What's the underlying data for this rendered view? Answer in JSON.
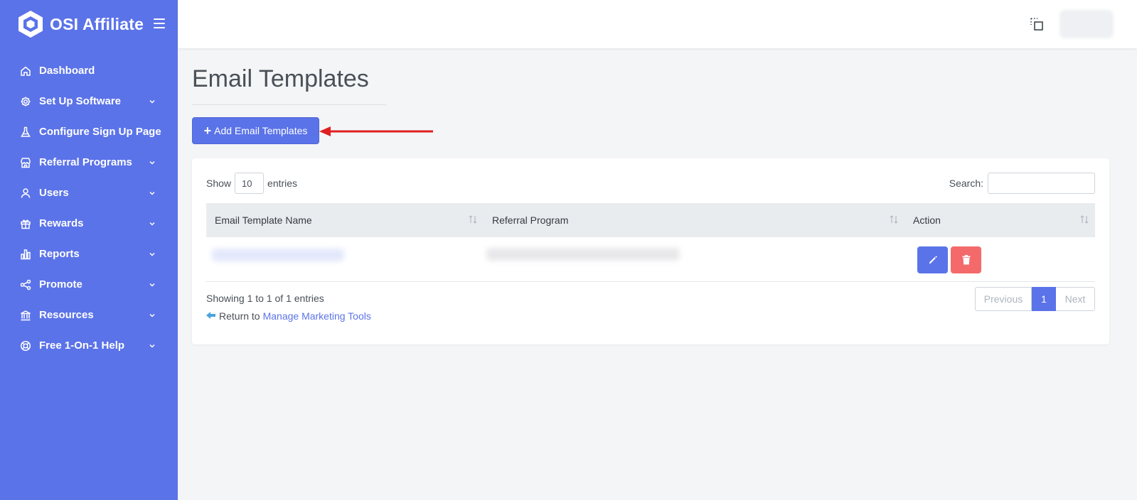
{
  "brand": {
    "name": "OSI Affiliate"
  },
  "sidebar": {
    "items": [
      {
        "label": "Dashboard",
        "icon": "home-icon",
        "has_submenu": false
      },
      {
        "label": "Set Up Software",
        "icon": "gear-icon",
        "has_submenu": true
      },
      {
        "label": "Configure Sign Up Page",
        "icon": "flask-icon",
        "has_submenu": false
      },
      {
        "label": "Referral Programs",
        "icon": "store-icon",
        "has_submenu": true
      },
      {
        "label": "Users",
        "icon": "user-icon",
        "has_submenu": true
      },
      {
        "label": "Rewards",
        "icon": "gift-icon",
        "has_submenu": true
      },
      {
        "label": "Reports",
        "icon": "bar-chart-icon",
        "has_submenu": true
      },
      {
        "label": "Promote",
        "icon": "share-icon",
        "has_submenu": true
      },
      {
        "label": "Resources",
        "icon": "bank-icon",
        "has_submenu": true
      },
      {
        "label": "Free 1-On-1 Help",
        "icon": "lifebuoy-icon",
        "has_submenu": true
      }
    ]
  },
  "page": {
    "title": "Email Templates",
    "add_button_label": "Add Email Templates"
  },
  "table": {
    "show_label": "Show",
    "page_length": "10",
    "entries_label": "entries",
    "search_label": "Search:",
    "search_value": "",
    "columns": [
      "Email Template Name",
      "Referral Program",
      "Action"
    ],
    "info": "Showing 1 to 1 of 1 entries",
    "pagination": {
      "previous": "Previous",
      "current": "1",
      "next": "Next"
    }
  },
  "footer_link": {
    "prefix": "Return to",
    "link_text": "Manage Marketing Tools"
  },
  "colors": {
    "primary": "#5b73e8",
    "danger": "#f46a6a",
    "annotation_arrow": "#e02020"
  }
}
